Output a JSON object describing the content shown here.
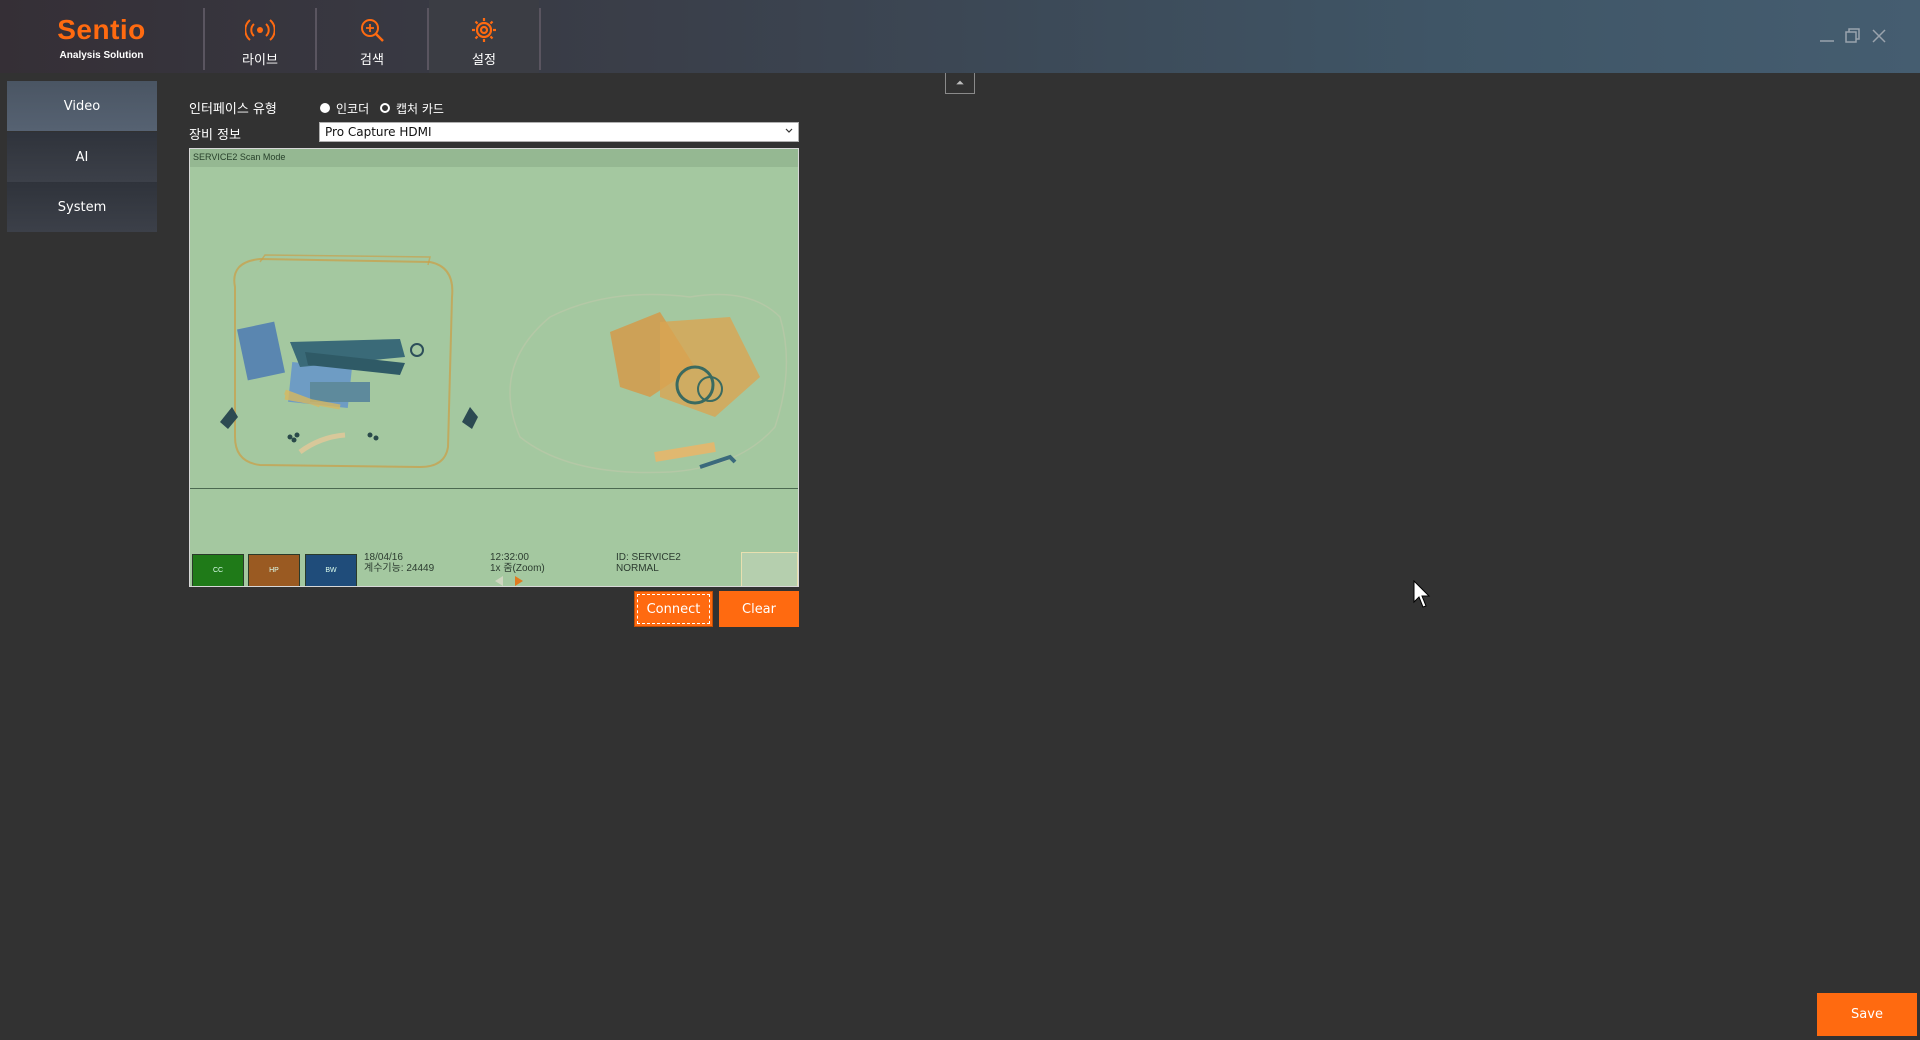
{
  "brand": {
    "name": "Sentio",
    "subtitle": "Analysis Solution"
  },
  "nav": {
    "tabs": [
      {
        "label": "라이브",
        "icon": "live-broadcast-icon"
      },
      {
        "label": "검색",
        "icon": "search-icon"
      },
      {
        "label": "설정",
        "icon": "gear-icon",
        "active": true
      }
    ]
  },
  "window_controls": {
    "icons": [
      "minimize-icon",
      "restore-icon",
      "close-icon"
    ]
  },
  "sidebar": {
    "items": [
      {
        "label": "Video",
        "active": true
      },
      {
        "label": "AI"
      },
      {
        "label": "System"
      }
    ]
  },
  "form": {
    "interface_label": "인터페이스 유형",
    "interface_options": [
      "인코더",
      "캡처 카드"
    ],
    "interface_selected": "캡처 카드",
    "device_label": "장비 정보",
    "device_value": "Pro Capture HDMI"
  },
  "preview": {
    "header_text": "SERVICE2 Scan Mode",
    "modes": [
      "CC",
      "HP",
      "BW"
    ],
    "date": "18/04/16",
    "counter": "계수기능: 24449",
    "time": "12:32:00",
    "zoom": "1x 줌(Zoom)",
    "id": "ID: SERVICE2",
    "status": "NORMAL"
  },
  "buttons": {
    "connect": "Connect",
    "clear": "Clear",
    "save": "Save"
  },
  "colors": {
    "accent": "#ff6a10",
    "background": "#323232"
  }
}
